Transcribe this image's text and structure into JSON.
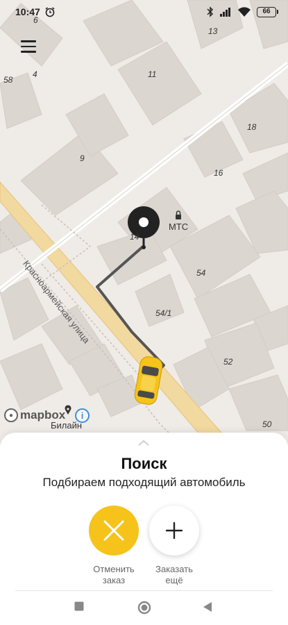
{
  "status_bar": {
    "time": "10:47",
    "battery": "66",
    "icons": [
      "alarm-icon",
      "bluetooth-icon",
      "signal-icon",
      "wifi-icon",
      "battery-icon"
    ]
  },
  "map": {
    "building_numbers": [
      "6",
      "13",
      "58",
      "4",
      "11",
      "18",
      "9",
      "16",
      "14",
      "54",
      "54/1",
      "52",
      "50"
    ],
    "street_name": "Красноармейская улица",
    "poi_mts": "МТС",
    "poi_beeline": "Билайн",
    "mapbox_text": "mapbox",
    "info_text": "i",
    "route_color": "#555555",
    "pin_color": "#222222",
    "car_color": "#f6c31b"
  },
  "sheet": {
    "title": "Поиск",
    "subtitle": "Подбираем подходящий автомобиль",
    "cancel_label_1": "Отменить",
    "cancel_label_2": "заказ",
    "add_label_1": "Заказать",
    "add_label_2": "ещё",
    "accent_color": "#f6c31b"
  },
  "nav": {
    "icons": [
      "recents-icon",
      "home-icon",
      "back-icon"
    ]
  }
}
